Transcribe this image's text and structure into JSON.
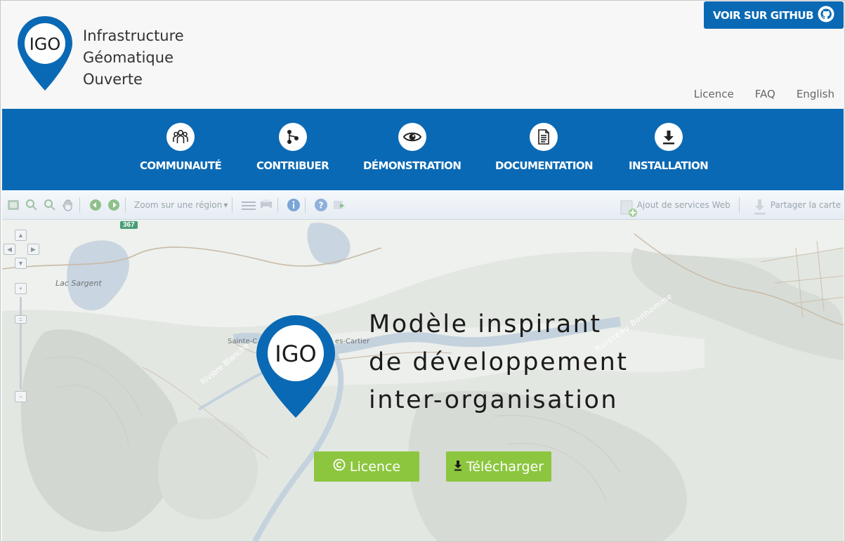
{
  "brand": {
    "logo_text": "IGO",
    "lines": [
      "Infrastructure",
      "Géomatique",
      "Ouverte"
    ]
  },
  "github_button": {
    "label": "VOIR SUR GITHUB"
  },
  "top_links": [
    {
      "label": "Licence"
    },
    {
      "label": "FAQ"
    },
    {
      "label": "English"
    }
  ],
  "nav": [
    {
      "label": "COMMUNAUTÉ",
      "icon": "community-icon"
    },
    {
      "label": "CONTRIBUER",
      "icon": "git-branch-icon"
    },
    {
      "label": "DÉMONSTRATION",
      "icon": "eye-icon"
    },
    {
      "label": "DOCUMENTATION",
      "icon": "document-icon"
    },
    {
      "label": "INSTALLATION",
      "icon": "download-icon"
    }
  ],
  "toolbar": {
    "zoom_region": "Zoom sur une région",
    "add_services": "Ajout de services Web",
    "share_map": "Partager la carte"
  },
  "map": {
    "labels": {
      "lake": "Lac Sargent",
      "town": "Sainte-C",
      "town2": "es-Cartier",
      "river1": "Rivière Blanche",
      "river2": "Ruisseau Bonhomme",
      "route": "367"
    }
  },
  "hero": {
    "logo_text": "IGO",
    "lines": [
      "Modèle inspirant",
      "de développement",
      "inter-organisation"
    ],
    "licence_button": "Licence",
    "download_button": "Télécharger"
  },
  "colors": {
    "brand_blue": "#0a69b4",
    "action_green": "#8cc63f",
    "header_bg": "#f7f7f7"
  }
}
